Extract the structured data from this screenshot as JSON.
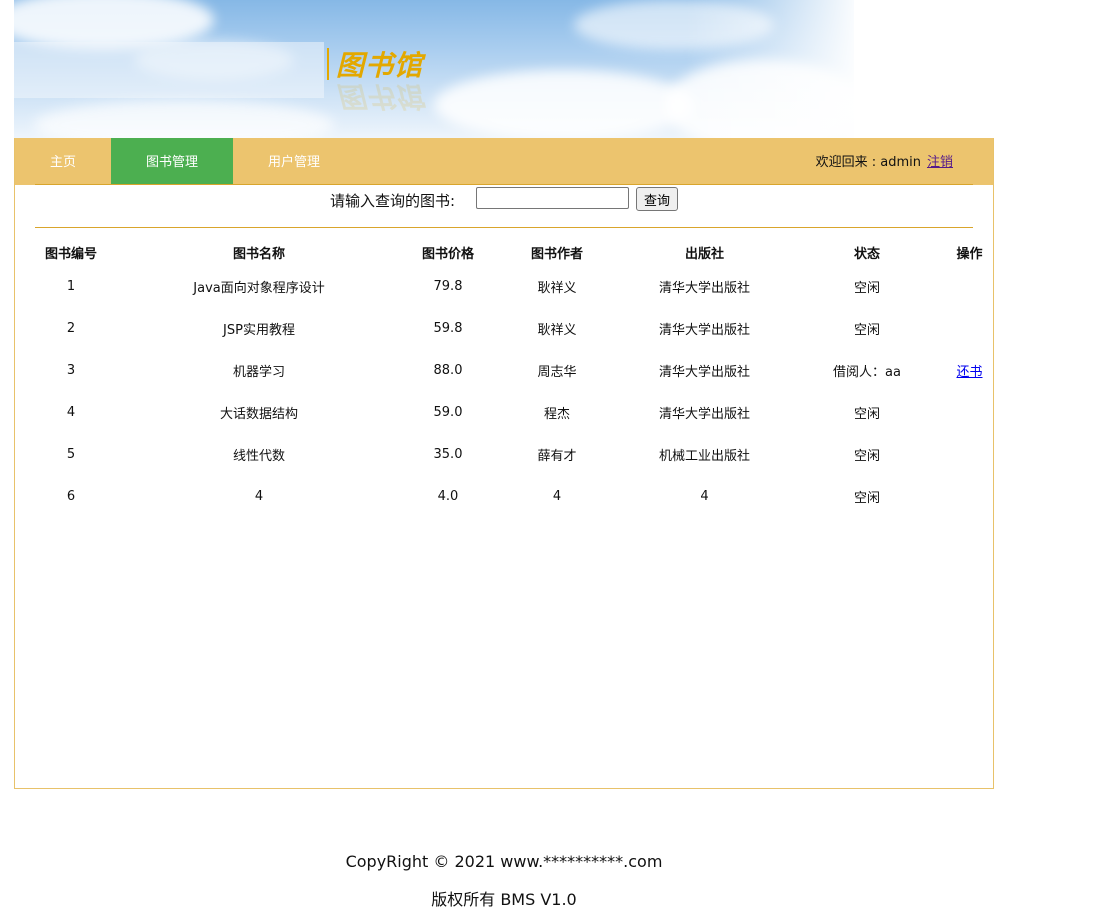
{
  "header": {
    "logo_text": "图书馆"
  },
  "nav": {
    "items": [
      {
        "label": "主页"
      },
      {
        "label": "图书管理"
      },
      {
        "label": "用户管理"
      }
    ],
    "active_index": 1,
    "welcome_text": "欢迎回来 : admin",
    "logout_label": "注销"
  },
  "search": {
    "label": "请输入查询的图书:",
    "value": "",
    "button_label": "查询"
  },
  "table": {
    "columns": [
      "图书编号",
      "图书名称",
      "图书价格",
      "图书作者",
      "出版社",
      "状态",
      "操作"
    ],
    "rows": [
      {
        "id": "1",
        "name": "Java面向对象程序设计",
        "price": "79.8",
        "author": "耿祥义",
        "publisher": "清华大学出版社",
        "status": "空闲",
        "action": ""
      },
      {
        "id": "2",
        "name": "JSP实用教程",
        "price": "59.8",
        "author": "耿祥义",
        "publisher": "清华大学出版社",
        "status": "空闲",
        "action": ""
      },
      {
        "id": "3",
        "name": "机器学习",
        "price": "88.0",
        "author": "周志华",
        "publisher": "清华大学出版社",
        "status": "借阅人：aa",
        "action": "还书"
      },
      {
        "id": "4",
        "name": "大话数据结构",
        "price": "59.0",
        "author": "程杰",
        "publisher": "清华大学出版社",
        "status": "空闲",
        "action": ""
      },
      {
        "id": "5",
        "name": "线性代数",
        "price": "35.0",
        "author": "薛有才",
        "publisher": "机械工业出版社",
        "status": "空闲",
        "action": ""
      },
      {
        "id": "6",
        "name": "4",
        "price": "4.0",
        "author": "4",
        "publisher": "4",
        "status": "空闲",
        "action": ""
      }
    ]
  },
  "footer": {
    "copyright": "CopyRight © 2021 www.**********.com",
    "version": "版权所有 BMS V1.0"
  },
  "colors": {
    "nav_bg": "#ecc46e",
    "nav_active": "#4caf50",
    "accent": "#e3a800"
  }
}
